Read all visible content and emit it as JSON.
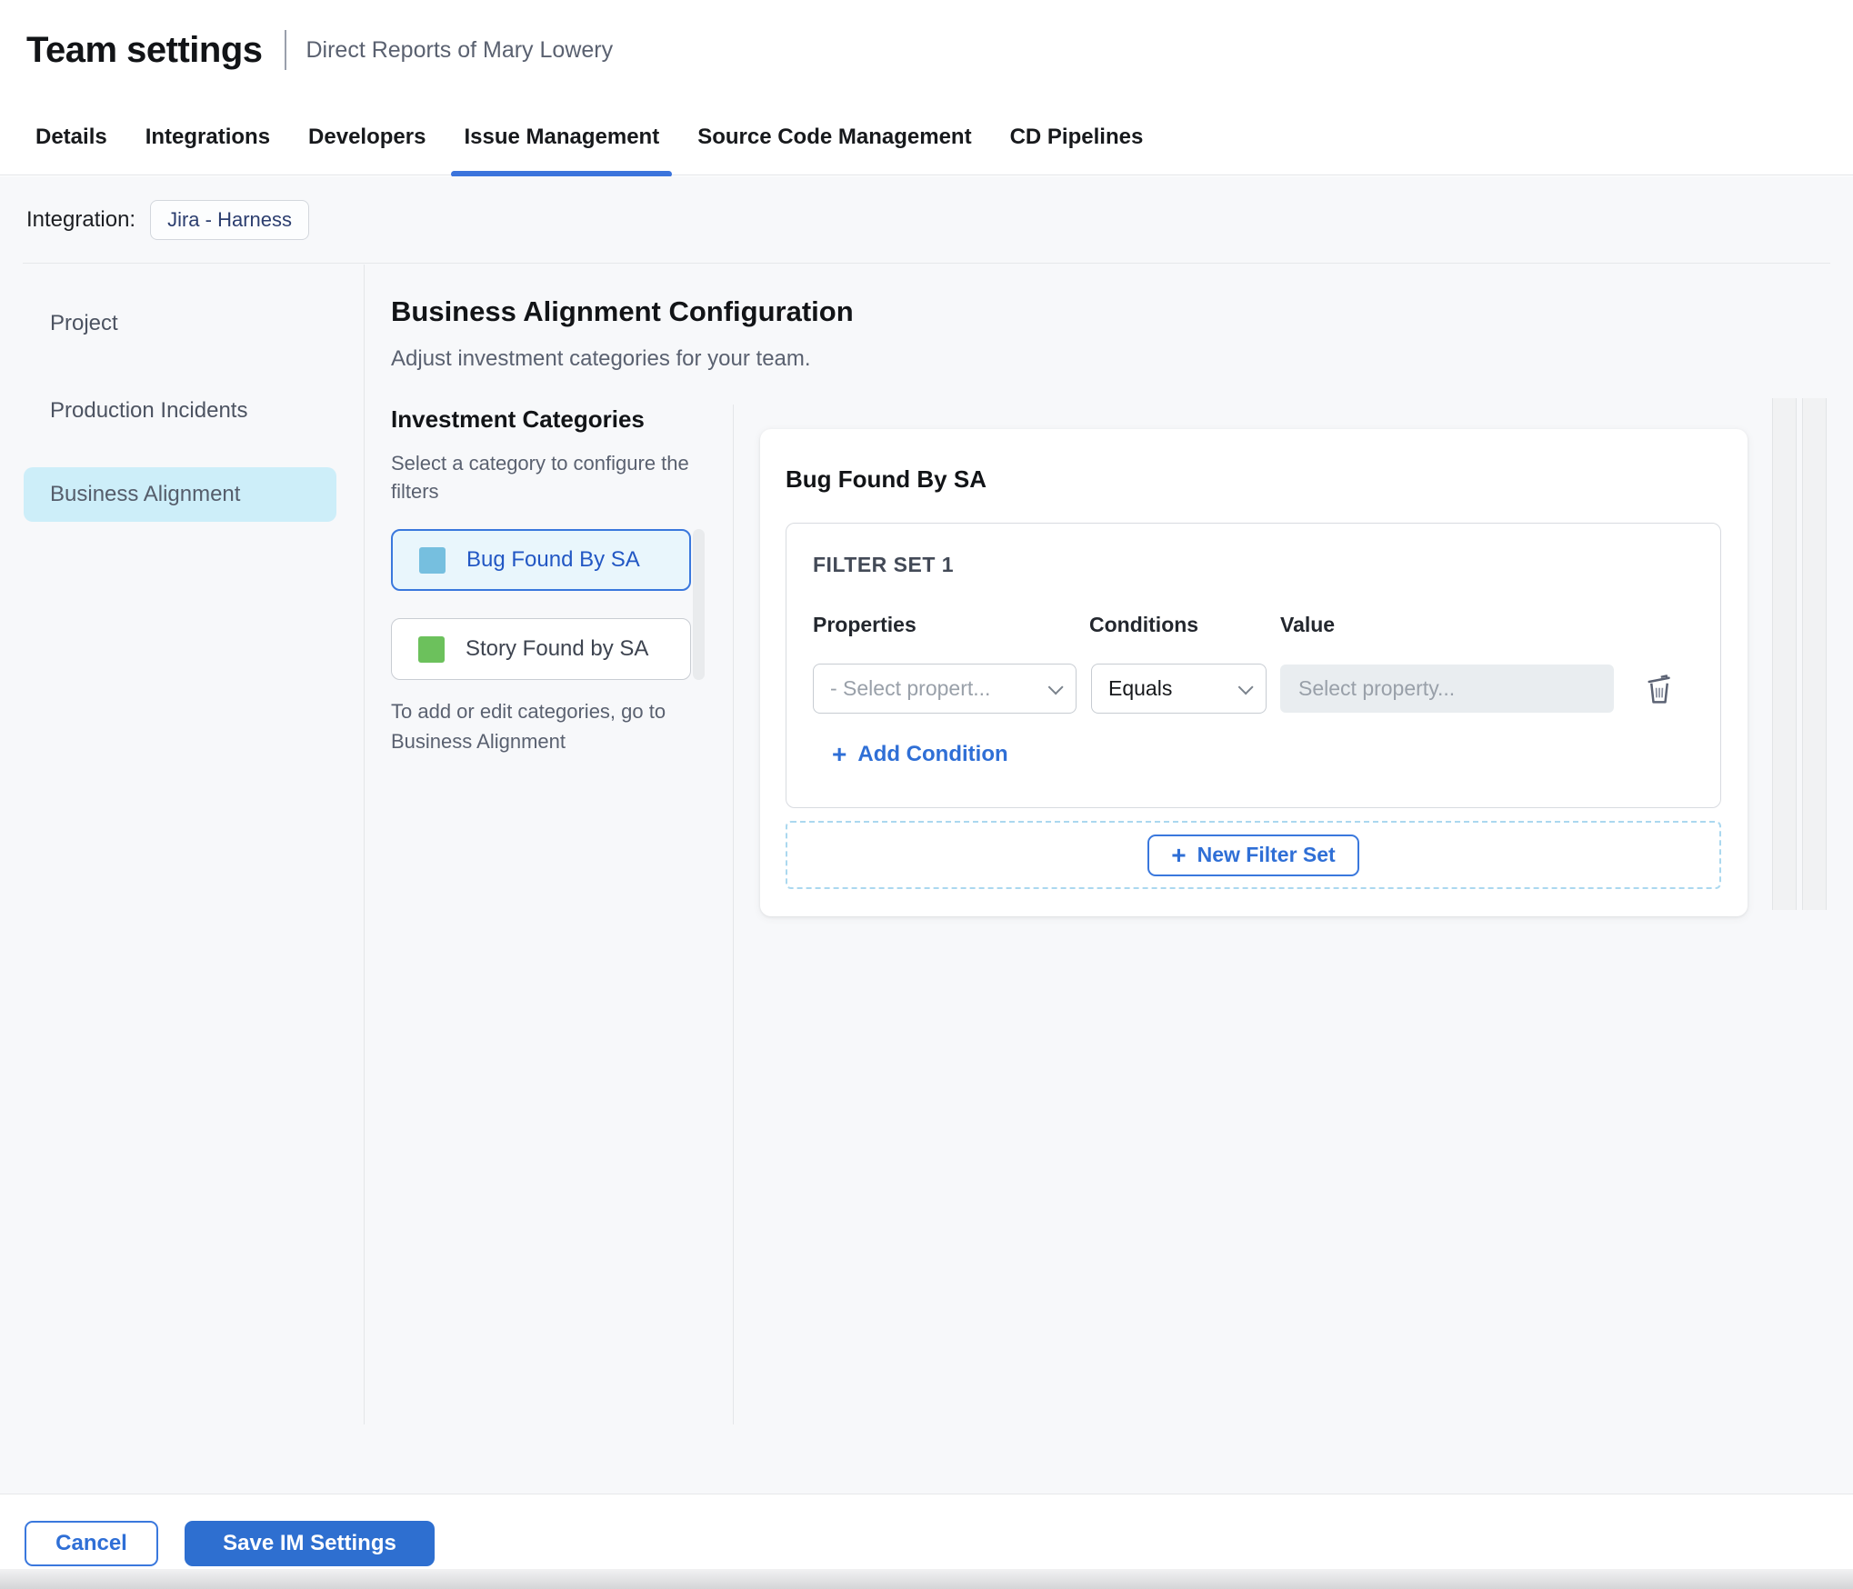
{
  "header": {
    "title": "Team settings",
    "subtitle": "Direct Reports of Mary Lowery"
  },
  "tabs": [
    {
      "label": "Details",
      "active": false
    },
    {
      "label": "Integrations",
      "active": false
    },
    {
      "label": "Developers",
      "active": false
    },
    {
      "label": "Issue Management",
      "active": true
    },
    {
      "label": "Source Code Management",
      "active": false
    },
    {
      "label": "CD Pipelines",
      "active": false
    }
  ],
  "integration": {
    "label": "Integration:",
    "chip": "Jira - Harness"
  },
  "sidebar": {
    "items": [
      {
        "label": "Project",
        "selected": false
      },
      {
        "label": "Production Incidents",
        "selected": false
      },
      {
        "label": "Business Alignment",
        "selected": true
      }
    ]
  },
  "main": {
    "title": "Business Alignment Configuration",
    "subtitle": "Adjust investment categories for your team.",
    "categories_panel": {
      "title": "Investment Categories",
      "hint": "Select a category to configure the filters",
      "items": [
        {
          "label": "Bug Found By SA",
          "color": "#76bfdf",
          "selected": true
        },
        {
          "label": "Story Found by SA",
          "color": "#6cc15c",
          "selected": false
        }
      ],
      "footnote": "To add or edit categories, go to Business Alignment"
    },
    "filter_panel": {
      "title": "Bug Found By SA",
      "filter_set": {
        "title": "FILTER SET 1",
        "columns": {
          "properties": "Properties",
          "conditions": "Conditions",
          "value": "Value"
        },
        "property_placeholder": "- Select propert...",
        "condition_selected": "Equals",
        "value_placeholder": "Select property...",
        "add_condition_label": "Add Condition"
      },
      "new_filter_set_label": "New Filter Set"
    }
  },
  "footer": {
    "cancel_label": "Cancel",
    "save_label": "Save IM Settings"
  },
  "colors": {
    "accent_blue": "#2f6fd6",
    "tab_underline": "#3b74dc",
    "save_button": "#2e6fd0",
    "sidebar_selected_bg": "#cdeef9",
    "category_selected_bg": "#e9f6fc",
    "category_selected_text": "#2257c4",
    "chip_text": "#2c3e6f",
    "page_bg": "#f7f8fa",
    "disabled_input_bg": "#e9edf0",
    "dashed_border": "#abd8ef",
    "swatch_bug": "#76bfdf",
    "swatch_story": "#6cc15c"
  }
}
